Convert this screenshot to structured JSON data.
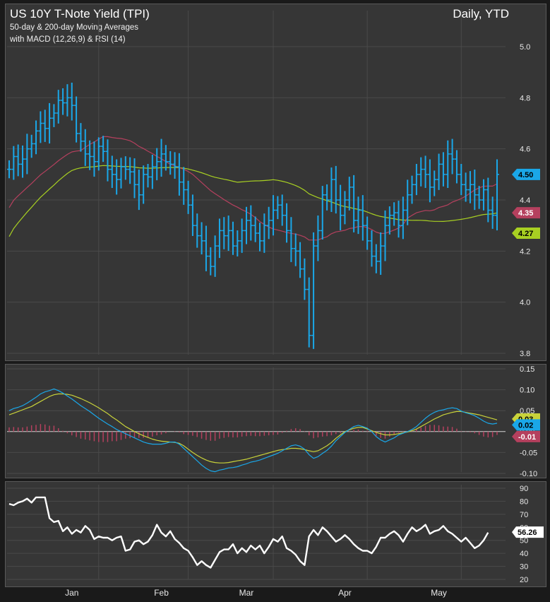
{
  "header": {
    "title": "US 10Y T-Note Yield (TPI)",
    "subtitle1": "50-day & 200-day Moving Averages",
    "subtitle2": "with MACD (12,26,9) & RSI (14)",
    "period": "Daily, YTD"
  },
  "colors": {
    "background": "#363636",
    "price": "#1aa7e8",
    "ma50": "#b5405e",
    "ma200": "#a8d022",
    "macd": "#1aa7e8",
    "signal": "#c8d23a",
    "histogram": "#b5405e",
    "rsi": "#ffffff"
  },
  "chart_data": [
    {
      "type": "ohlc",
      "ylim": [
        3.8,
        5.0
      ],
      "yticks": [
        "5.0",
        "4.8",
        "4.6",
        "4.4",
        "4.2",
        "4.0",
        "3.8"
      ],
      "x_labels": [
        "Jan",
        "Feb",
        "Mar",
        "Apr",
        "May"
      ],
      "x_label_index": [
        14,
        34,
        53,
        75,
        96
      ],
      "series": [
        {
          "id": "price",
          "close": [
            4.52,
            4.57,
            4.54,
            4.56,
            4.6,
            4.62,
            4.67,
            4.7,
            4.68,
            4.72,
            4.74,
            4.79,
            4.78,
            4.8,
            4.77,
            4.66,
            4.63,
            4.58,
            4.57,
            4.55,
            4.61,
            4.59,
            4.52,
            4.5,
            4.48,
            4.53,
            4.52,
            4.51,
            4.46,
            4.42,
            4.5,
            4.49,
            4.53,
            4.55,
            4.58,
            4.55,
            4.54,
            4.53,
            4.47,
            4.44,
            4.38,
            4.3,
            4.26,
            4.24,
            4.18,
            4.14,
            4.22,
            4.28,
            4.26,
            4.28,
            4.22,
            4.24,
            4.28,
            4.32,
            4.3,
            4.27,
            4.24,
            4.3,
            4.32,
            4.36,
            4.38,
            4.34,
            4.28,
            4.21,
            4.2,
            4.13,
            4.05,
            3.87,
            4.22,
            4.28,
            4.42,
            4.4,
            4.48,
            4.4,
            4.34,
            4.4,
            4.45,
            4.32,
            4.36,
            4.3,
            4.24,
            4.18,
            4.16,
            4.22,
            4.3,
            4.34,
            4.35,
            4.3,
            4.36,
            4.42,
            4.46,
            4.5,
            4.52,
            4.5,
            4.45,
            4.48,
            4.54,
            4.5,
            4.58,
            4.56,
            4.5,
            4.46,
            4.44,
            4.46,
            4.42,
            4.4,
            4.44,
            4.36,
            4.34,
            4.5
          ]
        },
        {
          "id": "ma50",
          "name": "",
          "last": "4.35"
        },
        {
          "id": "ma200",
          "name": "",
          "last": "4.27"
        }
      ],
      "last_price": "4.50"
    },
    {
      "type": "line",
      "ylim": [
        -0.1,
        0.15
      ],
      "yticks": [
        "0.15",
        "0.10",
        "0.05",
        "0.00",
        "-0.05",
        "-0.10"
      ],
      "macd": [
        0.05,
        0.055,
        0.058,
        0.062,
        0.068,
        0.075,
        0.082,
        0.09,
        0.095,
        0.098,
        0.102,
        0.098,
        0.092,
        0.085,
        0.078,
        0.07,
        0.062,
        0.055,
        0.048,
        0.04,
        0.032,
        0.025,
        0.018,
        0.012,
        0.005,
        0.0,
        -0.005,
        -0.01,
        -0.015,
        -0.02,
        -0.025,
        -0.028,
        -0.03,
        -0.03,
        -0.03,
        -0.028,
        -0.025,
        -0.025,
        -0.03,
        -0.04,
        -0.05,
        -0.06,
        -0.07,
        -0.08,
        -0.088,
        -0.094,
        -0.096,
        -0.092,
        -0.09,
        -0.087,
        -0.086,
        -0.084,
        -0.08,
        -0.077,
        -0.073,
        -0.071,
        -0.068,
        -0.064,
        -0.06,
        -0.056,
        -0.052,
        -0.046,
        -0.04,
        -0.034,
        -0.032,
        -0.035,
        -0.042,
        -0.055,
        -0.064,
        -0.06,
        -0.052,
        -0.045,
        -0.035,
        -0.022,
        -0.012,
        -0.002,
        0.005,
        0.012,
        0.015,
        0.012,
        0.008,
        0.0,
        -0.012,
        -0.02,
        -0.025,
        -0.02,
        -0.015,
        -0.008,
        -0.004,
        0.0,
        0.005,
        0.012,
        0.022,
        0.032,
        0.04,
        0.046,
        0.05,
        0.052,
        0.055,
        0.057,
        0.055,
        0.049,
        0.045,
        0.042,
        0.038,
        0.032,
        0.025,
        0.02,
        0.018,
        0.02
      ],
      "signal": [
        0.04,
        0.044,
        0.048,
        0.052,
        0.056,
        0.06,
        0.066,
        0.072,
        0.078,
        0.084,
        0.088,
        0.09,
        0.09,
        0.089,
        0.087,
        0.083,
        0.079,
        0.074,
        0.069,
        0.063,
        0.057,
        0.05,
        0.043,
        0.035,
        0.028,
        0.02,
        0.012,
        0.006,
        0.0,
        -0.005,
        -0.01,
        -0.014,
        -0.018,
        -0.021,
        -0.023,
        -0.024,
        -0.025,
        -0.026,
        -0.028,
        -0.034,
        -0.042,
        -0.05,
        -0.057,
        -0.063,
        -0.068,
        -0.072,
        -0.074,
        -0.075,
        -0.075,
        -0.074,
        -0.072,
        -0.07,
        -0.068,
        -0.066,
        -0.063,
        -0.06,
        -0.057,
        -0.054,
        -0.051,
        -0.048,
        -0.045,
        -0.043,
        -0.042,
        -0.04,
        -0.04,
        -0.041,
        -0.043,
        -0.046,
        -0.048,
        -0.046,
        -0.04,
        -0.034,
        -0.026,
        -0.016,
        -0.008,
        0.0,
        0.004,
        0.008,
        0.01,
        0.01,
        0.006,
        0.002,
        -0.002,
        -0.005,
        -0.008,
        -0.008,
        -0.007,
        -0.005,
        -0.003,
        -0.001,
        0.002,
        0.006,
        0.012,
        0.018,
        0.024,
        0.03,
        0.035,
        0.04,
        0.043,
        0.046,
        0.048,
        0.048,
        0.046,
        0.044,
        0.042,
        0.04,
        0.037,
        0.034,
        0.031,
        0.028
      ],
      "last_signal": "0.03",
      "last_macd": "0.02",
      "last_hist": "-0.01"
    },
    {
      "type": "line",
      "ylim": [
        20,
        90
      ],
      "yticks": [
        "90",
        "80",
        "70",
        "60",
        "50",
        "40",
        "30",
        "20"
      ],
      "rsi": [
        78,
        77,
        79,
        80,
        82,
        79,
        83,
        83,
        83,
        67,
        64,
        65,
        57,
        60,
        55,
        58,
        56,
        61,
        58,
        51,
        53,
        52,
        52,
        50,
        52,
        53,
        42,
        43,
        49,
        50,
        47,
        49,
        54,
        62,
        56,
        53,
        57,
        51,
        48,
        44,
        42,
        37,
        31,
        34,
        31,
        29,
        35,
        41,
        43,
        43,
        47,
        40,
        44,
        41,
        46,
        43,
        46,
        40,
        45,
        51,
        49,
        53,
        44,
        42,
        39,
        34,
        31,
        53,
        58,
        54,
        60,
        57,
        53,
        49,
        51,
        54,
        51,
        47,
        44,
        42,
        42,
        40,
        45,
        52,
        52,
        55,
        57,
        54,
        49,
        55,
        60,
        57,
        59,
        62,
        55,
        57,
        58,
        61,
        57,
        55,
        52,
        49,
        52,
        48,
        44,
        46,
        50,
        56
      ],
      "last_rsi": "56.26"
    }
  ]
}
